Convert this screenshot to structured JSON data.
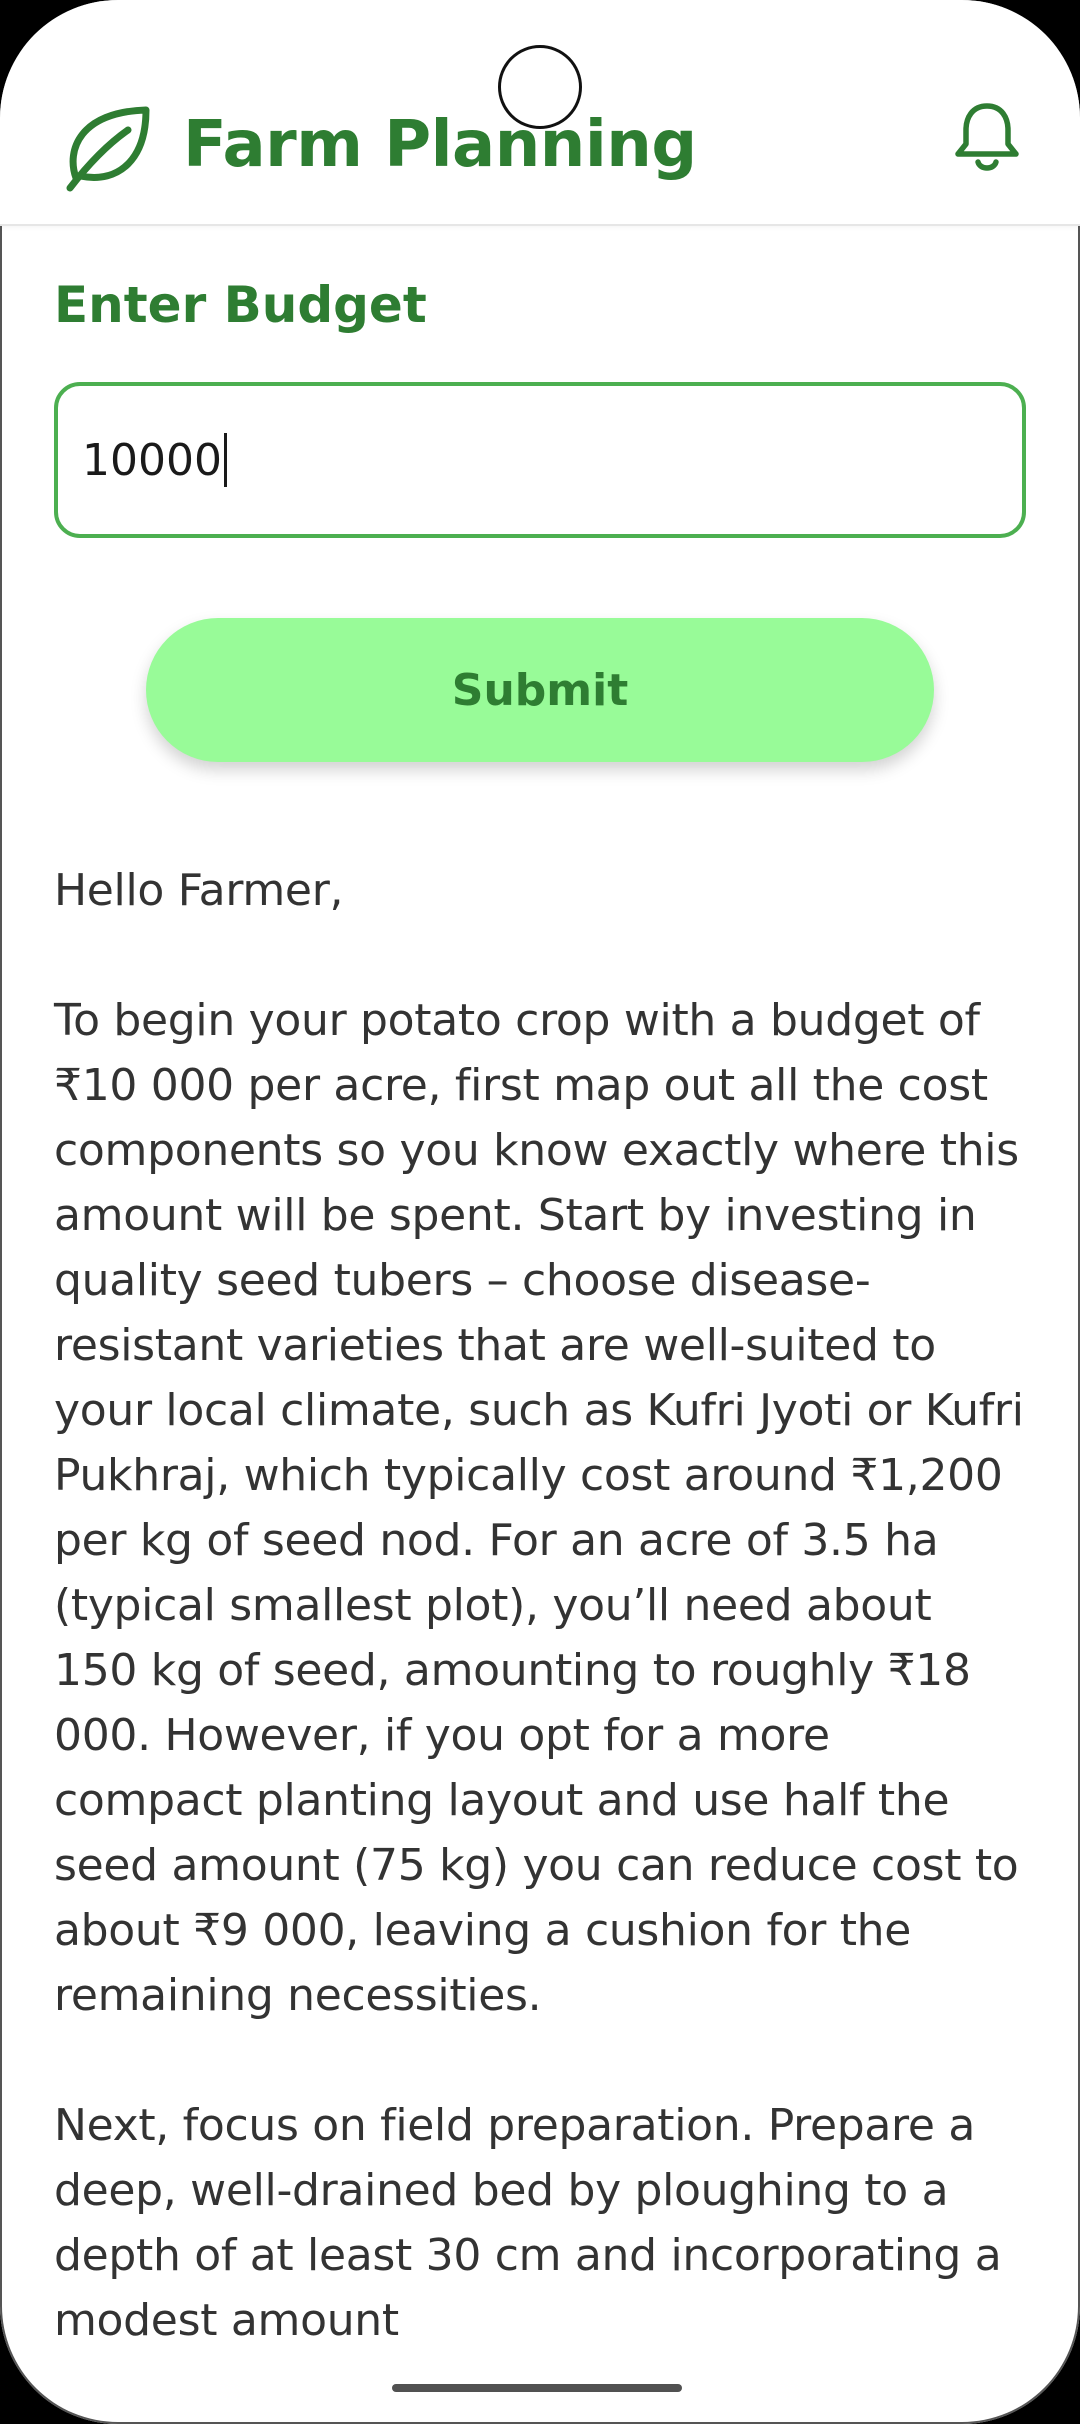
{
  "app_bar": {
    "title": "Farm Planning",
    "logo_icon": "leaf-icon",
    "notification_icon": "bell-icon"
  },
  "budget_form": {
    "label": "Enter Budget",
    "input_value": "10000",
    "submit_label": "Submit"
  },
  "response": {
    "greeting": "Hello Farmer,",
    "paragraphs": [
      "To begin your potato crop with a budget of ₹10 000 per acre, first map out all the cost components so you know exactly where this amount will be spent. Start by investing in quality seed tubers – choose disease-resistant varieties that are well-suited to your local climate, such as Kufri Jyoti or Kufri Pukhraj, which typically cost around ₹1,200 per kg of seed nod. For an acre of 3.5 ha (typical smallest plot), you’ll need about 150 kg of seed, amounting to roughly ₹18 000. However, if you opt for a more compact planting layout and use half the seed amount (75 kg) you can reduce cost to about ₹9 000, leaving a cushion for the remaining necessities.",
      "Next, focus on field preparation. Prepare a deep, well-drained bed by ploughing to a depth of at least 30 cm and incorporating a modest amount"
    ]
  },
  "colors": {
    "brand_green": "#2e7d32",
    "input_border": "#4caf50",
    "button_bg": "#98fb98",
    "body_text": "#333333"
  }
}
